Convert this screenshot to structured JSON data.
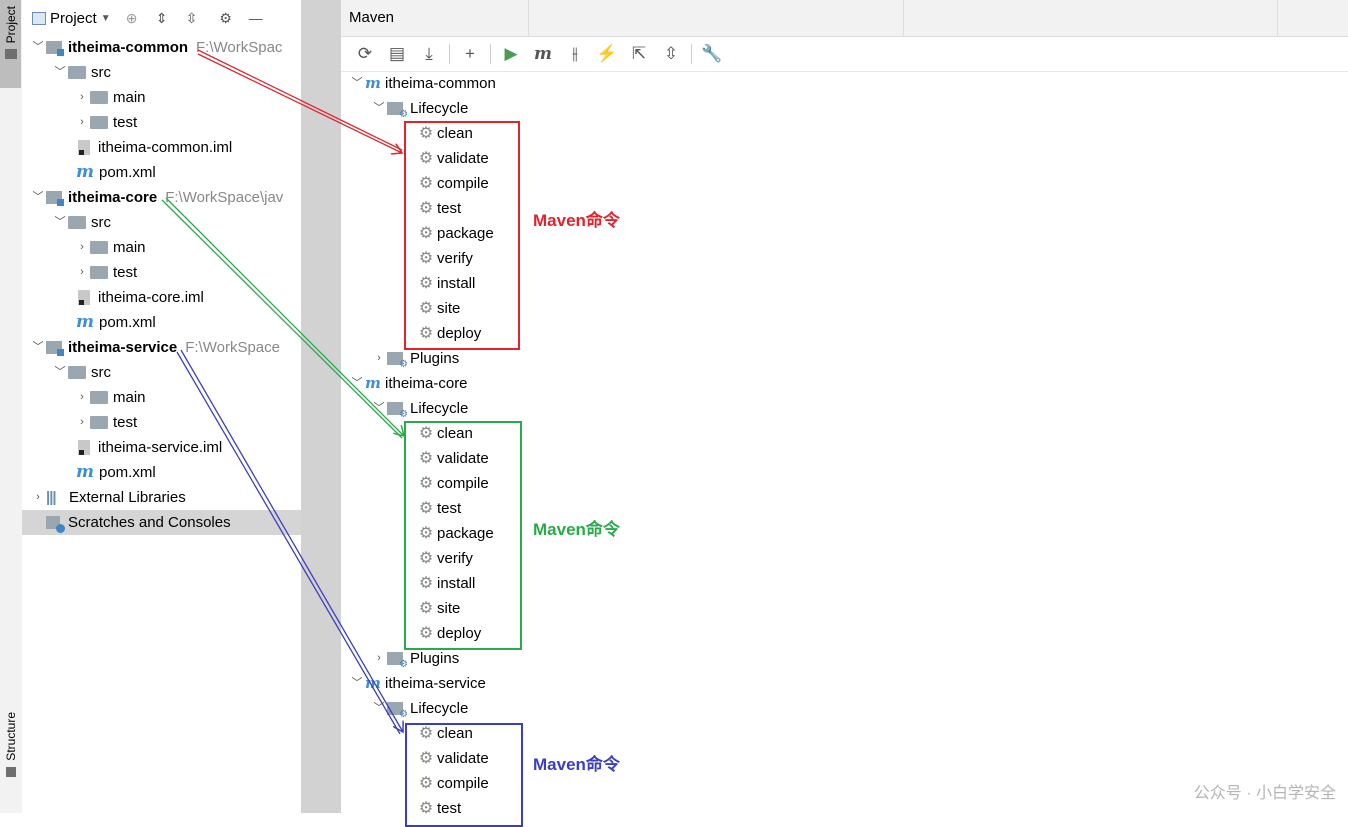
{
  "stripe": {
    "project_label": "Project",
    "structure_label": "Structure"
  },
  "project_panel": {
    "title": "Project",
    "tree": [
      {
        "label": "itheima-common",
        "path": "F:\\WorkSpac"
      },
      {
        "label": "src"
      },
      {
        "label": "main"
      },
      {
        "label": "test"
      },
      {
        "label": "itheima-common.iml"
      },
      {
        "label": "pom.xml"
      },
      {
        "label": "itheima-core",
        "path": "F:\\WorkSpace\\jav"
      },
      {
        "label": "src"
      },
      {
        "label": "main"
      },
      {
        "label": "test"
      },
      {
        "label": "itheima-core.iml"
      },
      {
        "label": "pom.xml"
      },
      {
        "label": "itheima-service",
        "path": "F:\\WorkSpace"
      },
      {
        "label": "src"
      },
      {
        "label": "main"
      },
      {
        "label": "test"
      },
      {
        "label": "itheima-service.iml"
      },
      {
        "label": "pom.xml"
      },
      {
        "label": "External Libraries"
      },
      {
        "label": "Scratches and Consoles"
      }
    ]
  },
  "maven_panel": {
    "title": "Maven",
    "modules": [
      {
        "name": "itheima-common",
        "lifecycle_label": "Lifecycle",
        "phases": [
          "clean",
          "validate",
          "compile",
          "test",
          "package",
          "verify",
          "install",
          "site",
          "deploy"
        ],
        "plugins_label": "Plugins"
      },
      {
        "name": "itheima-core",
        "lifecycle_label": "Lifecycle",
        "phases": [
          "clean",
          "validate",
          "compile",
          "test",
          "package",
          "verify",
          "install",
          "site",
          "deploy"
        ],
        "plugins_label": "Plugins"
      },
      {
        "name": "itheima-service",
        "lifecycle_label": "Lifecycle",
        "phases": [
          "clean",
          "validate",
          "compile",
          "test"
        ]
      }
    ]
  },
  "annotations": [
    {
      "text": "Maven命令",
      "color": "#e0242c"
    },
    {
      "text": "Maven命令",
      "color": "#2aaa4a"
    },
    {
      "text": "Maven命令",
      "color": "#3b3fbf"
    }
  ],
  "watermark": "公众号 · 小白学安全"
}
